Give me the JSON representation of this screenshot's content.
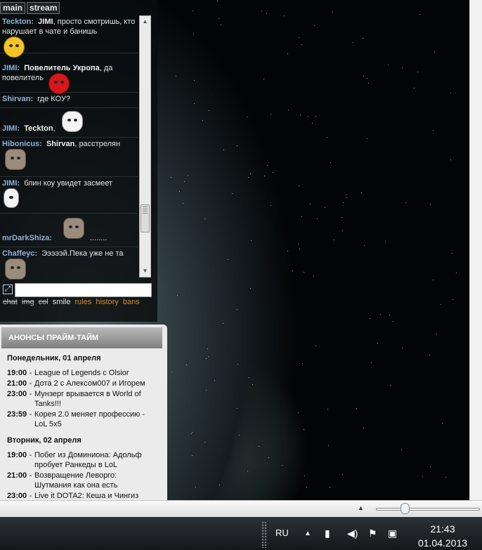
{
  "chat": {
    "tabs": [
      "main",
      "stream"
    ],
    "messages": [
      {
        "nick": "Teckton",
        "mention": "JIMI",
        "text": ", просто смотришь, кто нарушает в чате и банишь",
        "emote": "emote-yellow"
      },
      {
        "nick": "JIMI",
        "mention": "Повелитель Укропа",
        "text": ", да повелитель",
        "emote": "emote-red"
      },
      {
        "nick": "Shirvan",
        "mention": "",
        "text": "где КОУ?",
        "emote": ""
      },
      {
        "nick": "JIMI",
        "mention": "Teckton",
        "text": ",",
        "emote": "emote-white"
      },
      {
        "nick": "Hibonicus",
        "mention": "Shirvan",
        "text": ", расстрелян",
        "emote": "emote-cat"
      },
      {
        "nick": "JIMI",
        "mention": "",
        "text": "блин коу увидет засмеет",
        "emote": "emote-white"
      },
      {
        "nick": "mrDarkShiza",
        "mention": "",
        "text": "........",
        "emote": "emote-cat"
      },
      {
        "nick": "Chaffeyc",
        "mention": "",
        "text": "Эээээй.Пека уже не та",
        "emote": "emote-cat"
      }
    ],
    "input_value": "",
    "links": {
      "struck": [
        "chat",
        "img",
        "col"
      ],
      "plain": [
        "smile"
      ],
      "active": [
        "rules",
        "history",
        "bans"
      ]
    }
  },
  "announcements": {
    "title": "АНОНСЫ ПРАЙМ-ТАЙМ",
    "days": [
      {
        "day": "Понедельник, 01 апреля",
        "events": [
          {
            "time": "19:00",
            "title": "League of Legends с Olsior"
          },
          {
            "time": "21:00",
            "title": "Дота 2 с Алексом007 и Игорем"
          },
          {
            "time": "23:00",
            "title": "Мунзерг врывается в World of Tanks!!!"
          },
          {
            "time": "23:59",
            "title": "Корея 2.0 меняет профессию - LoL 5x5"
          }
        ]
      },
      {
        "day": "Вторник, 02 апреля",
        "events": [
          {
            "time": "19:00",
            "title": "Побег из Доминиона: Адольф пробует Ранкеды в LoL"
          },
          {
            "time": "21:00",
            "title": "Возвращение Леворго: Шутмания как она есть"
          },
          {
            "time": "23:00",
            "title": "Live it DOTA2: Кеша и Чингиз"
          }
        ]
      }
    ]
  },
  "taskbar": {
    "language": "RU",
    "time": "21:43",
    "date": "01.04.2013"
  },
  "colors": {
    "nick": "#8fb2d8",
    "link_active": "#e08a1e",
    "link_struck": "#bbbbbb"
  }
}
